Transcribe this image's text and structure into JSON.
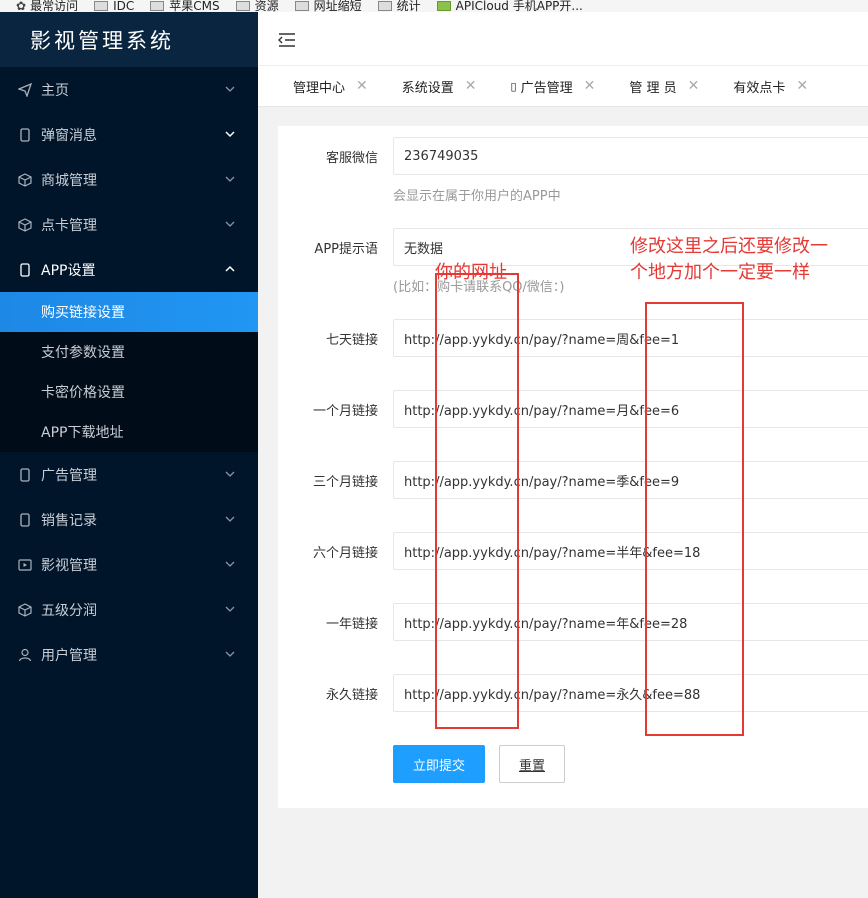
{
  "bookmarks": [
    {
      "label": "最常访问",
      "icon": "gear-icon"
    },
    {
      "label": "IDC",
      "icon": "folder-icon"
    },
    {
      "label": "苹果CMS",
      "icon": "folder-icon"
    },
    {
      "label": "资源",
      "icon": "folder-icon"
    },
    {
      "label": "网址缩短",
      "icon": "folder-icon"
    },
    {
      "label": "统计",
      "icon": "folder-icon"
    },
    {
      "label": "APICloud 手机APP开...",
      "icon": "apicloud-icon"
    }
  ],
  "app": {
    "title": "影视管理系统"
  },
  "sidebar": {
    "items": [
      {
        "label": "主页",
        "icon": "paper-plane-icon"
      },
      {
        "label": "弹窗消息",
        "icon": "phone-icon"
      },
      {
        "label": "商城管理",
        "icon": "cube-icon"
      },
      {
        "label": "点卡管理",
        "icon": "cube-icon"
      },
      {
        "label": "APP设置",
        "icon": "phone-icon"
      },
      {
        "label": "广告管理",
        "icon": "phone-icon"
      },
      {
        "label": "销售记录",
        "icon": "phone-icon"
      },
      {
        "label": "影视管理",
        "icon": "video-icon"
      },
      {
        "label": "五级分润",
        "icon": "cube-icon"
      },
      {
        "label": "用户管理",
        "icon": "user-icon"
      }
    ],
    "submenu": [
      {
        "label": "购买链接设置",
        "active": true
      },
      {
        "label": "支付参数设置",
        "active": false
      },
      {
        "label": "卡密价格设置",
        "active": false
      },
      {
        "label": "APP下载地址",
        "active": false
      }
    ]
  },
  "tabs": [
    "管理中心",
    "系统设置",
    "广告管理",
    "管 理 员",
    "有效点卡"
  ],
  "form": {
    "wechat_label": "客服微信",
    "wechat_value": "236749035",
    "wechat_hint": "会显示在属于你用户的APP中",
    "prompt_label": "APP提示语",
    "prompt_value": "无数据",
    "prompt_hint": "(比如：购卡请联系QQ/微信：)",
    "links": [
      {
        "label": "七天链接",
        "value": "http://app.yykdy.cn/pay/?name=周&fee=1"
      },
      {
        "label": "一个月链接",
        "value": "http://app.yykdy.cn/pay/?name=月&fee=6"
      },
      {
        "label": "三个月链接",
        "value": "http://app.yykdy.cn/pay/?name=季&fee=9"
      },
      {
        "label": "六个月链接",
        "value": "http://app.yykdy.cn/pay/?name=半年&fee=18"
      },
      {
        "label": "一年链接",
        "value": "http://app.yykdy.cn/pay/?name=年&fee=28"
      },
      {
        "label": "永久链接",
        "value": "http://app.yykdy.cn/pay/?name=永久&fee=88"
      }
    ],
    "submit_label": "立即提交",
    "reset_label": "重置"
  },
  "annotations": {
    "left_note": "你的网址",
    "right_note_line1": "修改这里之后还要修改一",
    "right_note_line2": "个地方加个一定要一样"
  },
  "colors": {
    "sidebar_bg": "#001529",
    "active_item": "#1e88e5",
    "primary_button": "#1e9fff",
    "annotation": "#e53935"
  }
}
